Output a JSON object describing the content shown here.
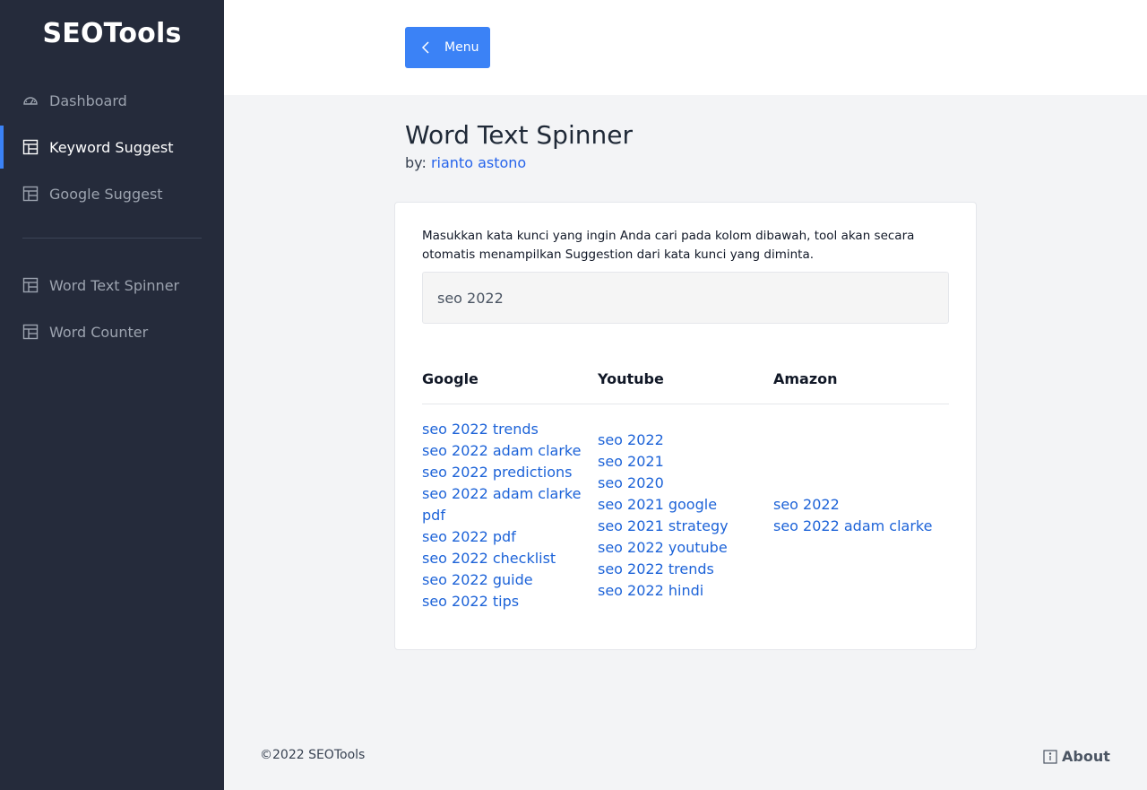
{
  "app": {
    "brand": "SEOTools"
  },
  "sidebar": {
    "items": [
      {
        "label": "Dashboard",
        "icon": "dashboard-icon",
        "active": false
      },
      {
        "label": "Keyword Suggest",
        "icon": "table-icon",
        "active": true
      },
      {
        "label": "Google Suggest",
        "icon": "table-icon",
        "active": false
      },
      {
        "label": "Word Text Spinner",
        "icon": "table-icon",
        "active": false
      },
      {
        "label": "Word Counter",
        "icon": "table-icon",
        "active": false
      }
    ]
  },
  "topbar": {
    "menu_label": "Menu",
    "menu_icon": "chevron-left-icon"
  },
  "page": {
    "title": "Word Text Spinner",
    "by_prefix": "by:",
    "author": "rianto astono"
  },
  "card": {
    "description": "Masukkan kata kunci yang ingin Anda cari pada kolom dibawah, tool akan secara otomatis menampilkan Suggestion dari kata kunci yang diminta.",
    "search_value": "seo 2022",
    "columns": [
      {
        "heading": "Google",
        "items": [
          "seo 2022 trends",
          "seo 2022 adam clarke",
          "seo 2022 predictions",
          "seo 2022 adam clarke pdf",
          "seo 2022 pdf",
          "seo 2022 checklist",
          "seo 2022 guide",
          "seo 2022 tips"
        ]
      },
      {
        "heading": "Youtube",
        "items": [
          "seo 2022",
          "seo 2021",
          "seo 2020",
          "seo 2021 google",
          "seo 2021 strategy",
          "seo 2022 youtube",
          "seo 2022 trends",
          "seo 2022 hindi"
        ]
      },
      {
        "heading": "Amazon",
        "items": [
          "seo 2022",
          "seo 2022 adam clarke"
        ]
      }
    ]
  },
  "footer": {
    "copyright": "©2022 SEOTools",
    "about_label": "About",
    "about_icon": "info-icon"
  },
  "colors": {
    "sidebar_bg": "#252b3b",
    "accent": "#3b82f6",
    "link": "#1d63d8",
    "page_bg": "#f3f4f6"
  }
}
